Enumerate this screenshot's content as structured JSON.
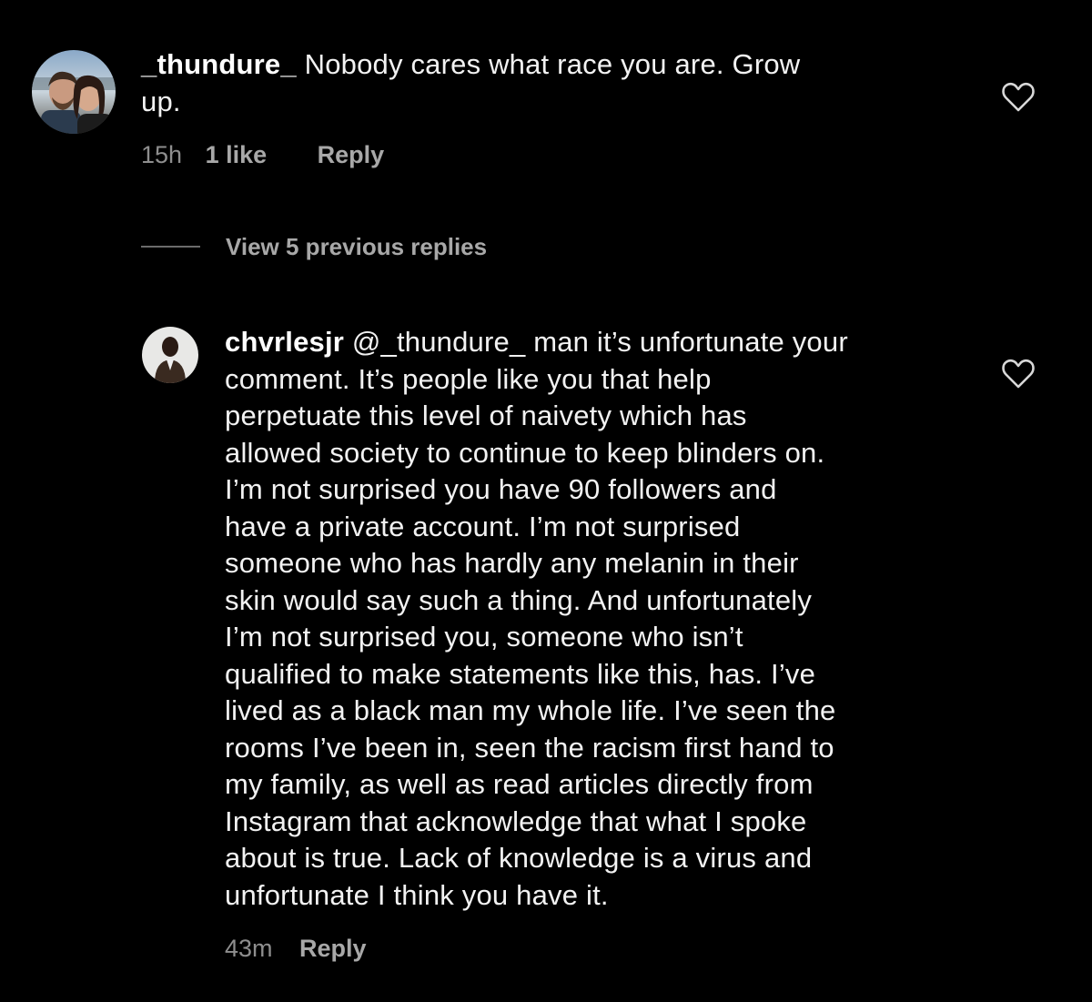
{
  "comments": [
    {
      "username": "_thundure_",
      "text_lines": [
        " Nobody cares what race you are. Grow",
        "up."
      ],
      "time": "15h",
      "likes": "1 like",
      "reply_label": "Reply",
      "avatar_icon": "profile-photo-couple"
    },
    {
      "username": "chvrlesjr",
      "text_lines": [
        " @_thundure_ man it’s unfortunate your",
        "comment. It’s people like you that help",
        "perpetuate this level of naivety which has",
        "allowed society to continue to keep blinders on.",
        "I’m not surprised you have 90 followers and",
        "have a private account. I’m not surprised",
        "someone who has hardly any melanin in their",
        "skin would say such a thing. And unfortunately",
        "I’m not surprised you, someone who isn’t",
        "qualified to make statements like this, has. I’ve",
        "lived as a black man my whole life. I’ve seen the",
        "rooms I’ve been in, seen the racism first hand to",
        "my family, as well as read articles directly from",
        "Instagram that acknowledge that what I spoke",
        "about is true. Lack of knowledge is a virus and",
        "unfortunate I think you have it."
      ],
      "time": "43m",
      "reply_label": "Reply",
      "avatar_icon": "profile-photo-man"
    }
  ],
  "view_replies_label": "View 5 previous replies",
  "colors": {
    "background": "#000000",
    "text": "#f2f2f2",
    "meta": "#8e8e8e"
  }
}
